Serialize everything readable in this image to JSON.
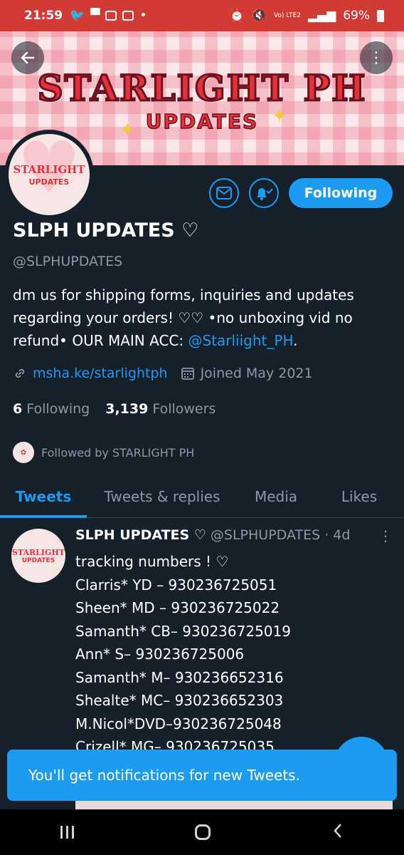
{
  "status_bar": {
    "time": "21:59",
    "network": "Vo) LTE2",
    "battery": "69%"
  },
  "banner": {
    "title": "STARLIGHT PH",
    "subtitle": "UPDATES"
  },
  "avatar": {
    "line1": "STARLIGHT",
    "line2": "UPDATES"
  },
  "profile": {
    "follow_label": "Following",
    "name": "SLPH UPDATES ♡",
    "handle": "@SLPHUPDATES",
    "bio": "dm us for shipping forms, inquiries and updates regarding your orders! ♡♡ •no unboxing vid no refund•  OUR MAIN ACC: ",
    "bio_mention": "@Starliight_PH",
    "bio_end": ".",
    "link": "msha.ke/starlightph",
    "joined": "Joined May 2021",
    "following_count": "6",
    "following_label": "Following",
    "followers_count": "3,139",
    "followers_label": "Followers",
    "followed_by": "Followed by STARLIGHT PH"
  },
  "tabs": [
    "Tweets",
    "Tweets & replies",
    "Media",
    "Likes"
  ],
  "tweet": {
    "name": "SLPH UPDATES ♡",
    "handle": "@SLPHUPDATES",
    "time": "· 4d",
    "lines": [
      "tracking numbers ! ♡",
      "Clarris* YD – 930236725051",
      "Sheen* MD – 930236725022",
      "Samanth* CB– 930236725019",
      "Ann* S– 930236725006",
      "Samanth* M– 930236652316",
      "Shealte* MC– 930236652303",
      "M.Nicol*DVD–930236725048",
      "Crizell* MG– 930236725035"
    ]
  },
  "toast": "You'll get notifications for new Tweets."
}
